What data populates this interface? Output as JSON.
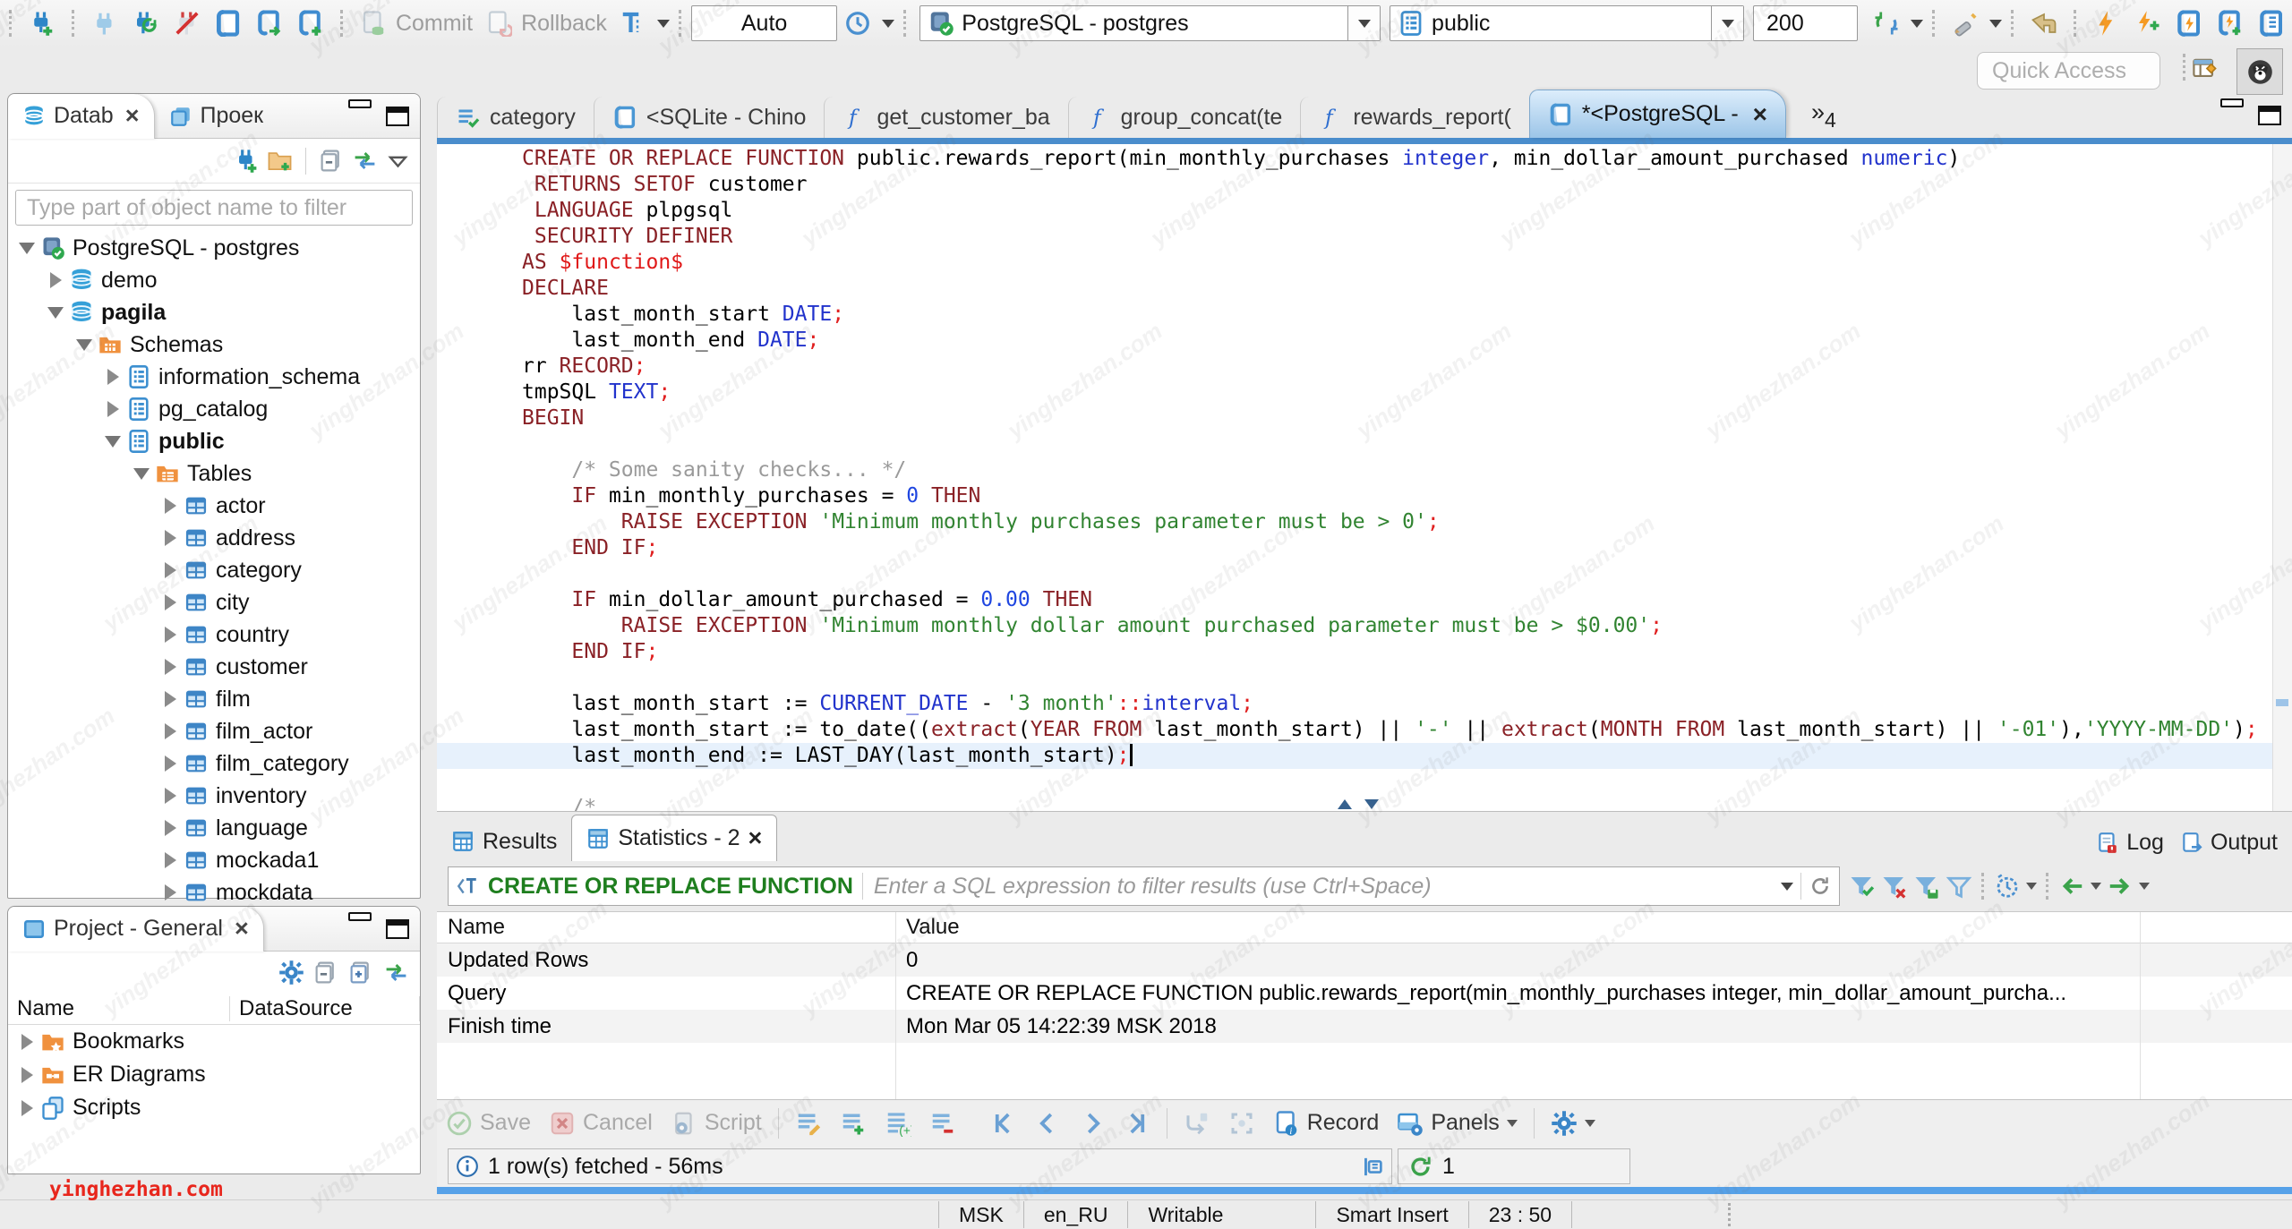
{
  "toolbar": {
    "commit": "Commit",
    "rollback": "Rollback",
    "auto": "Auto",
    "connection": "PostgreSQL - postgres",
    "schema": "public",
    "fetch_size": "200",
    "quick_access": "Quick Access"
  },
  "navigator": {
    "tab_db": "Datab",
    "tab_proj": "Проек",
    "filter_placeholder": "Type part of object name to filter",
    "tree": [
      {
        "label": "PostgreSQL - postgres",
        "level": 0,
        "arrow": "open",
        "icon": "pg"
      },
      {
        "label": "demo",
        "level": 1,
        "arrow": "closed",
        "icon": "db"
      },
      {
        "label": "pagila",
        "level": 1,
        "arrow": "open",
        "icon": "db",
        "bold": true
      },
      {
        "label": "Schemas",
        "level": 2,
        "arrow": "open",
        "icon": "folder-grid"
      },
      {
        "label": "information_schema",
        "level": 3,
        "arrow": "closed",
        "icon": "schema"
      },
      {
        "label": "pg_catalog",
        "level": 3,
        "arrow": "closed",
        "icon": "schema"
      },
      {
        "label": "public",
        "level": 3,
        "arrow": "open",
        "icon": "schema",
        "bold": true
      },
      {
        "label": "Tables",
        "level": 4,
        "arrow": "open",
        "icon": "folder-table"
      },
      {
        "label": "actor",
        "level": 5,
        "arrow": "closed",
        "icon": "table"
      },
      {
        "label": "address",
        "level": 5,
        "arrow": "closed",
        "icon": "table"
      },
      {
        "label": "category",
        "level": 5,
        "arrow": "closed",
        "icon": "table"
      },
      {
        "label": "city",
        "level": 5,
        "arrow": "closed",
        "icon": "table"
      },
      {
        "label": "country",
        "level": 5,
        "arrow": "closed",
        "icon": "table"
      },
      {
        "label": "customer",
        "level": 5,
        "arrow": "closed",
        "icon": "table"
      },
      {
        "label": "film",
        "level": 5,
        "arrow": "closed",
        "icon": "table"
      },
      {
        "label": "film_actor",
        "level": 5,
        "arrow": "closed",
        "icon": "table"
      },
      {
        "label": "film_category",
        "level": 5,
        "arrow": "closed",
        "icon": "table"
      },
      {
        "label": "inventory",
        "level": 5,
        "arrow": "closed",
        "icon": "table"
      },
      {
        "label": "language",
        "level": 5,
        "arrow": "closed",
        "icon": "table"
      },
      {
        "label": "mockada1",
        "level": 5,
        "arrow": "closed",
        "icon": "table"
      },
      {
        "label": "mockdata",
        "level": 5,
        "arrow": "closed",
        "icon": "table"
      }
    ]
  },
  "project": {
    "title": "Project - General",
    "col_name": "Name",
    "col_datasource": "DataSource",
    "items": [
      {
        "label": "Bookmarks",
        "icon": "folder-star"
      },
      {
        "label": "ER Diagrams",
        "icon": "folder-er"
      },
      {
        "label": "Scripts",
        "icon": "scripts"
      }
    ]
  },
  "editor": {
    "tabs": [
      {
        "label": "category",
        "icon": "grid-check"
      },
      {
        "label": "<SQLite - Chino",
        "icon": "sqlpage"
      },
      {
        "label": "get_customer_ba",
        "icon": "func"
      },
      {
        "label": "group_concat(te",
        "icon": "func"
      },
      {
        "label": "rewards_report(",
        "icon": "func"
      },
      {
        "label": "*<PostgreSQL - ",
        "icon": "sqlpage",
        "active": true,
        "close": true
      }
    ],
    "overflow_count": "4",
    "highlight_line": 23,
    "code": [
      [
        [
          "ck",
          "CREATE OR REPLACE FUNCTION"
        ],
        [
          "cp",
          " public.rewards_report(min_monthly_purchases "
        ],
        [
          "ct",
          "integer"
        ],
        [
          "cp",
          ", min_dollar_amount_purchased "
        ],
        [
          "ct",
          "numeric"
        ],
        [
          "cp",
          ")"
        ]
      ],
      [
        [
          "ck",
          " RETURNS SETOF"
        ],
        [
          "cp",
          " customer"
        ]
      ],
      [
        [
          "ck",
          " LANGUAGE"
        ],
        [
          "cp",
          " plpgsql"
        ]
      ],
      [
        [
          "ck",
          " SECURITY DEFINER"
        ]
      ],
      [
        [
          "ck",
          "AS"
        ],
        [
          "cp",
          " "
        ],
        [
          "cd",
          "$function$"
        ]
      ],
      [
        [
          "ck",
          "DECLARE"
        ]
      ],
      [
        [
          "cp",
          "    last_month_start "
        ],
        [
          "ct",
          "DATE"
        ],
        [
          "cr",
          ";"
        ]
      ],
      [
        [
          "cp",
          "    last_month_end "
        ],
        [
          "ct",
          "DATE"
        ],
        [
          "cr",
          ";"
        ]
      ],
      [
        [
          "cp",
          "rr "
        ],
        [
          "ck",
          "RECORD"
        ],
        [
          "cr",
          ";"
        ]
      ],
      [
        [
          "cp",
          "tmpSQL "
        ],
        [
          "ct",
          "TEXT"
        ],
        [
          "cr",
          ";"
        ]
      ],
      [
        [
          "ck",
          "BEGIN"
        ]
      ],
      [],
      [
        [
          "cp",
          "    "
        ],
        [
          "cc",
          "/* Some sanity checks... */"
        ]
      ],
      [
        [
          "cp",
          "    "
        ],
        [
          "ck",
          "IF"
        ],
        [
          "cp",
          " min_monthly_purchases = "
        ],
        [
          "cn",
          "0"
        ],
        [
          "ck",
          " THEN"
        ]
      ],
      [
        [
          "cp",
          "        "
        ],
        [
          "ck",
          "RAISE EXCEPTION"
        ],
        [
          "cp",
          " "
        ],
        [
          "cs",
          "'Minimum monthly purchases parameter must be > 0'"
        ],
        [
          "cr",
          ";"
        ]
      ],
      [
        [
          "cp",
          "    "
        ],
        [
          "ck",
          "END IF"
        ],
        [
          "cr",
          ";"
        ]
      ],
      [],
      [
        [
          "cp",
          "    "
        ],
        [
          "ck",
          "IF"
        ],
        [
          "cp",
          " min_dollar_amount_purchased = "
        ],
        [
          "cn",
          "0.00"
        ],
        [
          "ck",
          " THEN"
        ]
      ],
      [
        [
          "cp",
          "        "
        ],
        [
          "ck",
          "RAISE EXCEPTION"
        ],
        [
          "cp",
          " "
        ],
        [
          "cs",
          "'Minimum monthly dollar amount purchased parameter must be > $0.00'"
        ],
        [
          "cr",
          ";"
        ]
      ],
      [
        [
          "cp",
          "    "
        ],
        [
          "ck",
          "END IF"
        ],
        [
          "cr",
          ";"
        ]
      ],
      [],
      [
        [
          "cp",
          "    last_month_start := "
        ],
        [
          "ct",
          "CURRENT_DATE"
        ],
        [
          "cp",
          " - "
        ],
        [
          "cs",
          "'3 month'"
        ],
        [
          "cr",
          "::"
        ],
        [
          "ct",
          "interval"
        ],
        [
          "cr",
          ";"
        ]
      ],
      [
        [
          "cp",
          "    last_month_start := to_date(("
        ],
        [
          "ck",
          "extract"
        ],
        [
          "cp",
          "("
        ],
        [
          "ck",
          "YEAR FROM"
        ],
        [
          "cp",
          " last_month_start) || "
        ],
        [
          "cs",
          "'-'"
        ],
        [
          "cp",
          " || "
        ],
        [
          "ck",
          "extract"
        ],
        [
          "cp",
          "("
        ],
        [
          "ck",
          "MONTH FROM"
        ],
        [
          "cp",
          " last_month_start) || "
        ],
        [
          "cs",
          "'-01'"
        ],
        [
          "cp",
          "),"
        ],
        [
          "cs",
          "'YYYY-MM-DD'"
        ],
        [
          "cp",
          ")"
        ],
        [
          "cr",
          ";"
        ]
      ],
      [
        [
          "cp",
          "    last_month_end := LAST_DAY(last_month_start)"
        ],
        [
          "cr",
          ";"
        ]
      ],
      [],
      [
        [
          "cp",
          "    "
        ],
        [
          "cc",
          "/*"
        ]
      ]
    ]
  },
  "results": {
    "tab_results": "Results",
    "tab_statistics": "Statistics - 2",
    "log": "Log",
    "output": "Output",
    "filter_prefix": "CREATE OR REPLACE FUNCTION",
    "filter_placeholder": "Enter a SQL expression to filter results (use Ctrl+Space)",
    "table": {
      "headers": [
        "Name",
        "Value"
      ],
      "rows": [
        [
          "Updated Rows",
          "0"
        ],
        [
          "Query",
          "CREATE OR REPLACE FUNCTION public.rewards_report(min_monthly_purchases integer, min_dollar_amount_purcha..."
        ],
        [
          "Finish time",
          "Mon Mar 05 14:22:39 MSK 2018"
        ]
      ]
    },
    "btn_save": "Save",
    "btn_cancel": "Cancel",
    "btn_script": "Script",
    "btn_record": "Record",
    "btn_panels": "Panels",
    "status": "1 row(s) fetched - 56ms",
    "exec_count": "1"
  },
  "statusbar": {
    "cells": [
      "MSK",
      "en_RU",
      "Writable",
      "Smart Insert",
      "23 : 50"
    ]
  },
  "watermark": {
    "text": "yinghezhan.com"
  },
  "colors": {
    "accent_blue": "#4a8dcc",
    "keyword": "#8a2126",
    "string": "#318431",
    "type": "#2233cc"
  }
}
